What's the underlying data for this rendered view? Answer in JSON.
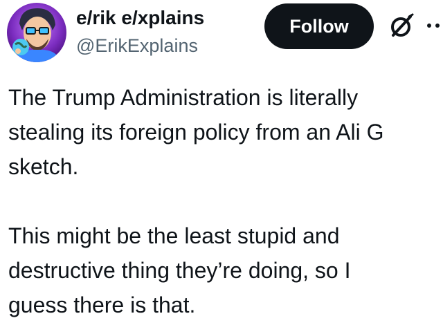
{
  "author": {
    "display_name": "e/rik e/xplains",
    "handle": "@ErikExplains"
  },
  "actions": {
    "follow_label": "Follow"
  },
  "icons": {
    "grok": "grok-icon",
    "more": "more-options-icon"
  },
  "tweet": {
    "text": "The Trump Administration is literally\nstealing its foreign policy from an Ali G\nsketch.\n\nThis might be the least stupid and\ndestructive thing they’re doing, so I\nguess there is that."
  }
}
